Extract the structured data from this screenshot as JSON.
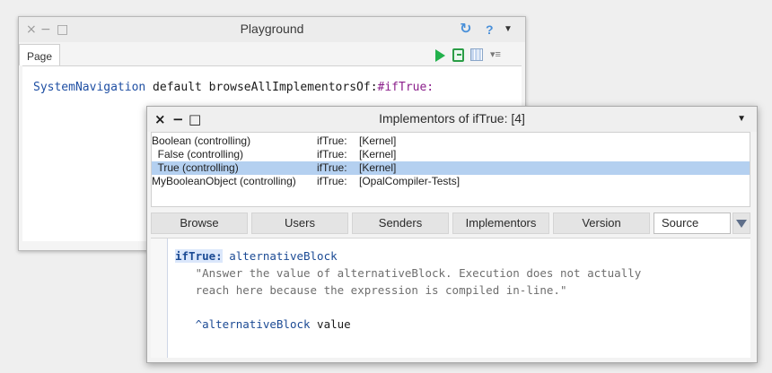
{
  "playground": {
    "title": "Playground",
    "controls": {
      "close": "×",
      "minimize": "−",
      "maximize": "□"
    },
    "help": "?",
    "tab": "Page",
    "code": {
      "class_name": "SystemNavigation",
      "message": " default browseAllImplementorsOf:",
      "symbol": "#ifTrue:"
    },
    "icons": [
      "refresh-icon",
      "help-icon",
      "menu-icon",
      "run-icon",
      "publish-icon",
      "bindings-icon",
      "dropdown-icon"
    ],
    "colors": {
      "run": "#22b14c",
      "accent": "#4a90d9",
      "symbol": "#8b1e8b",
      "class": "#1f4fa3"
    }
  },
  "implementors": {
    "title": "Implementors of ifTrue: [4]",
    "controls": {
      "close": "×",
      "minimize": "−",
      "maximize": "□"
    },
    "rows": [
      {
        "class": "Boolean (controlling)",
        "selector": "ifTrue:",
        "package": "[Kernel]",
        "selected": false
      },
      {
        "class": "  False (controlling)",
        "selector": "ifTrue:",
        "package": "[Kernel]",
        "selected": false
      },
      {
        "class": "  True (controlling)",
        "selector": "ifTrue:",
        "package": "[Kernel]",
        "selected": true
      },
      {
        "class": "MyBooleanObject (controlling)",
        "selector": "ifTrue:",
        "package": "[OpalCompiler-Tests]",
        "selected": false
      }
    ],
    "buttons": {
      "browse": "Browse",
      "users": "Users",
      "senders": "Senders",
      "implementors": "Implementors",
      "version": "Version",
      "source": "Source"
    },
    "source": {
      "selector": "ifTrue:",
      "argument": " alternativeBlock",
      "comment_line1": "\"Answer the value of alternativeBlock. Execution does not actually",
      "comment_line2": "reach here because the expression is compiled in-line.\"",
      "return_caret": "^",
      "return_receiver": "alternativeBlock",
      "return_message": " value"
    },
    "colors": {
      "selection": "#b4d0f0"
    }
  }
}
